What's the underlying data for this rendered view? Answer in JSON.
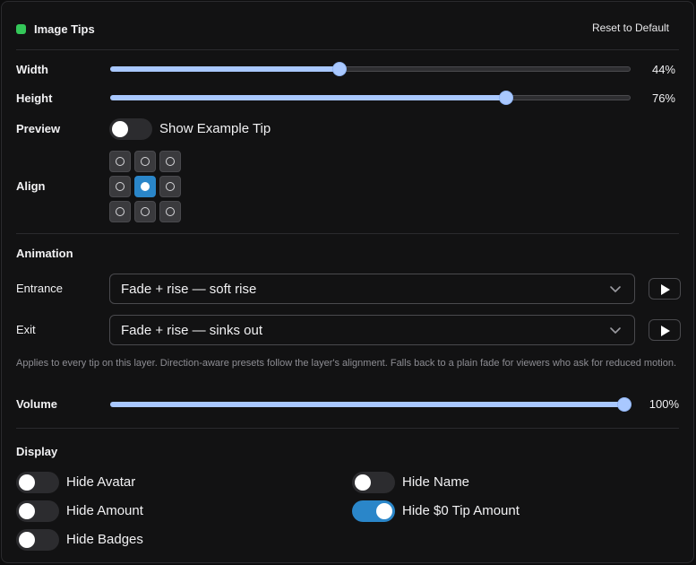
{
  "header": {
    "title": "Image Tips",
    "status_color": "#34c759",
    "reset_label": "Reset to Default"
  },
  "size": {
    "width": {
      "label": "Width",
      "value": 44,
      "value_text": "44%"
    },
    "height": {
      "label": "Height",
      "value": 76,
      "value_text": "76%"
    }
  },
  "preview": {
    "label": "Preview",
    "toggle_label": "Show Example Tip",
    "on": false
  },
  "align": {
    "label": "Align",
    "selected": "middle-center"
  },
  "animation": {
    "title": "Animation",
    "entrance": {
      "label": "Entrance",
      "selected": "Fade + rise — soft rise"
    },
    "exit": {
      "label": "Exit",
      "selected": "Fade + rise — sinks out"
    },
    "help": "Applies to every tip on this layer. Direction-aware presets follow the layer's alignment. Falls back to a plain fade for viewers who ask for reduced motion.",
    "volume": {
      "label": "Volume",
      "value": 100,
      "value_text": "100%"
    }
  },
  "display": {
    "title": "Display",
    "hide_avatar": {
      "label": "Hide Avatar",
      "on": false
    },
    "hide_name": {
      "label": "Hide Name",
      "on": false
    },
    "hide_amount": {
      "label": "Hide Amount",
      "on": false
    },
    "hide_zero_tip": {
      "label": "Hide $0 Tip Amount",
      "on": true
    },
    "hide_badges": {
      "label": "Hide Badges",
      "on": false
    }
  },
  "colors": {
    "accent": "#2a86c9",
    "slider": "#a9c8ff"
  }
}
